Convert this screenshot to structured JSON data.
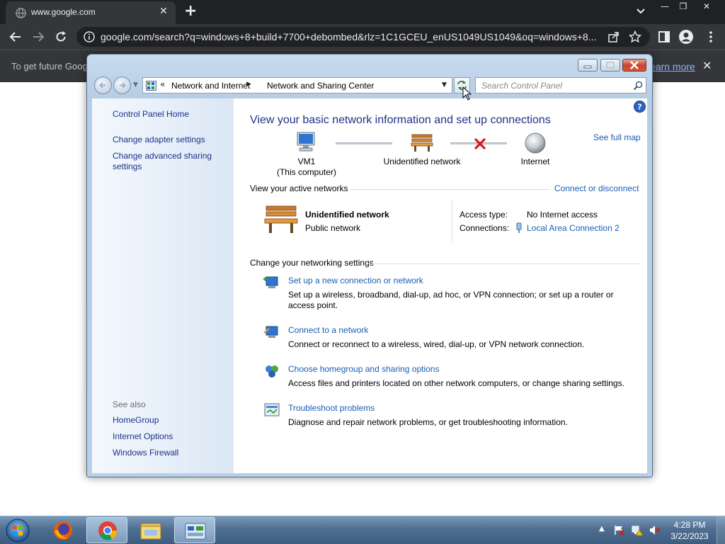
{
  "browser": {
    "tab_title": "www.google.com",
    "tab_close": "✕",
    "new_tab": "+",
    "url": "google.com/search?q=windows+8+build+7700+debombed&rlz=1C1GCEU_enUS1049US1049&oq=windows+8...",
    "infobar_text": "To get future Goog",
    "infobar_link": "earn more",
    "infobar_close": "✕",
    "window_controls": [
      "—",
      "❐",
      "✕"
    ]
  },
  "cp": {
    "breadcrumb_lead": "«",
    "breadcrumb": [
      "Network and Internet",
      "Network and Sharing Center"
    ],
    "search_placeholder": "Search Control Panel",
    "left_pane": {
      "home": "Control Panel Home",
      "links": [
        "Change adapter settings",
        "Change advanced sharing settings"
      ],
      "see_also_label": "See also",
      "see_also": [
        "HomeGroup",
        "Internet Options",
        "Windows Firewall"
      ]
    },
    "main": {
      "title": "View your basic network information and set up connections",
      "see_full_map": "See full map",
      "map": {
        "computer_name": "VM1",
        "computer_sub": "(This computer)",
        "network": "Unidentified network",
        "internet": "Internet"
      },
      "active_networks_head": "View your active networks",
      "connect_disconnect": "Connect or disconnect",
      "network": {
        "name": "Unidentified network",
        "type": "Public network",
        "access_type_label": "Access type:",
        "access_type_value": "No Internet access",
        "connections_label": "Connections:",
        "connections_value": "Local Area Connection 2"
      },
      "change_settings_head": "Change your networking settings",
      "tasks": [
        {
          "link": "Set up a new connection or network",
          "desc": "Set up a wireless, broadband, dial-up, ad hoc, or VPN connection; or set up a router or access point."
        },
        {
          "link": "Connect to a network",
          "desc": "Connect or reconnect to a wireless, wired, dial-up, or VPN network connection."
        },
        {
          "link": "Choose homegroup and sharing options",
          "desc": "Access files and printers located on other network computers, or change sharing settings."
        },
        {
          "link": "Troubleshoot problems",
          "desc": "Diagnose and repair network problems, or get troubleshooting information."
        }
      ]
    }
  },
  "taskbar": {
    "time": "4:28 PM",
    "date": "3/22/2023"
  },
  "colors": {
    "link_blue": "#1c5db3",
    "title_blue": "#1e3287",
    "chrome_dark": "#202124"
  }
}
